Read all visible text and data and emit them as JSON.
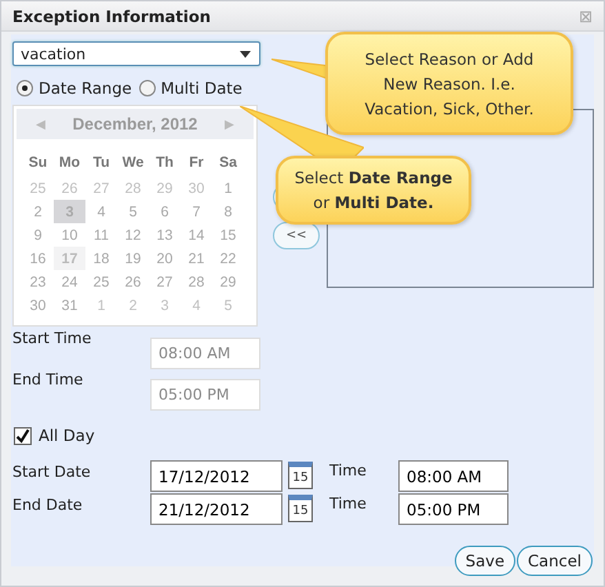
{
  "window": {
    "title": "Exception Information",
    "close": "⊠"
  },
  "reason": {
    "value": "vacation"
  },
  "mode": [
    {
      "label": "Date Range",
      "selected": true
    },
    {
      "label": "Multi Date",
      "selected": false
    }
  ],
  "calendar": {
    "prev": "◀",
    "title": "December, 2012",
    "next": "▶",
    "weekdays": [
      "Su",
      "Mo",
      "Tu",
      "We",
      "Th",
      "Fr",
      "Sa"
    ],
    "days": [
      {
        "day": "25",
        "kind": "other"
      },
      {
        "day": "26",
        "kind": "other"
      },
      {
        "day": "27",
        "kind": "other"
      },
      {
        "day": "28",
        "kind": "other"
      },
      {
        "day": "29",
        "kind": "other"
      },
      {
        "day": "30",
        "kind": "other"
      },
      {
        "day": "1",
        "kind": "current"
      },
      {
        "day": "2",
        "kind": "current"
      },
      {
        "day": "3",
        "kind": "today"
      },
      {
        "day": "4",
        "kind": "current"
      },
      {
        "day": "5",
        "kind": "current"
      },
      {
        "day": "6",
        "kind": "current"
      },
      {
        "day": "7",
        "kind": "current"
      },
      {
        "day": "8",
        "kind": "current"
      },
      {
        "day": "9",
        "kind": "current"
      },
      {
        "day": "10",
        "kind": "current"
      },
      {
        "day": "11",
        "kind": "current"
      },
      {
        "day": "12",
        "kind": "current"
      },
      {
        "day": "13",
        "kind": "current"
      },
      {
        "day": "14",
        "kind": "current"
      },
      {
        "day": "15",
        "kind": "current"
      },
      {
        "day": "16",
        "kind": "current"
      },
      {
        "day": "17",
        "kind": "marked"
      },
      {
        "day": "18",
        "kind": "current"
      },
      {
        "day": "19",
        "kind": "current"
      },
      {
        "day": "20",
        "kind": "current"
      },
      {
        "day": "21",
        "kind": "current"
      },
      {
        "day": "22",
        "kind": "current"
      },
      {
        "day": "23",
        "kind": "current"
      },
      {
        "day": "24",
        "kind": "current"
      },
      {
        "day": "25",
        "kind": "current"
      },
      {
        "day": "26",
        "kind": "current"
      },
      {
        "day": "27",
        "kind": "current"
      },
      {
        "day": "28",
        "kind": "current"
      },
      {
        "day": "29",
        "kind": "current"
      },
      {
        "day": "30",
        "kind": "current"
      },
      {
        "day": "31",
        "kind": "current"
      },
      {
        "day": "1",
        "kind": "other"
      },
      {
        "day": "2",
        "kind": "other"
      },
      {
        "day": "3",
        "kind": "other"
      },
      {
        "day": "4",
        "kind": "other"
      },
      {
        "day": "5",
        "kind": "other"
      }
    ]
  },
  "remove_button": "<<",
  "times": [
    {
      "label": "Start Time",
      "value": "08:00 AM",
      "disabled": true
    },
    {
      "label": "End Time",
      "value": "05:00 PM",
      "disabled": true
    }
  ],
  "all_day": {
    "label": "All Day",
    "checked": true
  },
  "dates": [
    {
      "label": "Start Date",
      "value": "17/12/2012",
      "icon_day": "15",
      "time_label": "Time",
      "time": "08:00 AM"
    },
    {
      "label": "End Date",
      "value": "21/12/2012",
      "icon_day": "15",
      "time_label": "Time",
      "time": "05:00 PM"
    }
  ],
  "buttons": [
    "Save",
    "Cancel"
  ],
  "callouts": [
    "Select Reason or Add New Reason. I.e. Vacation, Sick, Other.",
    "Select **Date Range** or **Multi Date.**"
  ]
}
